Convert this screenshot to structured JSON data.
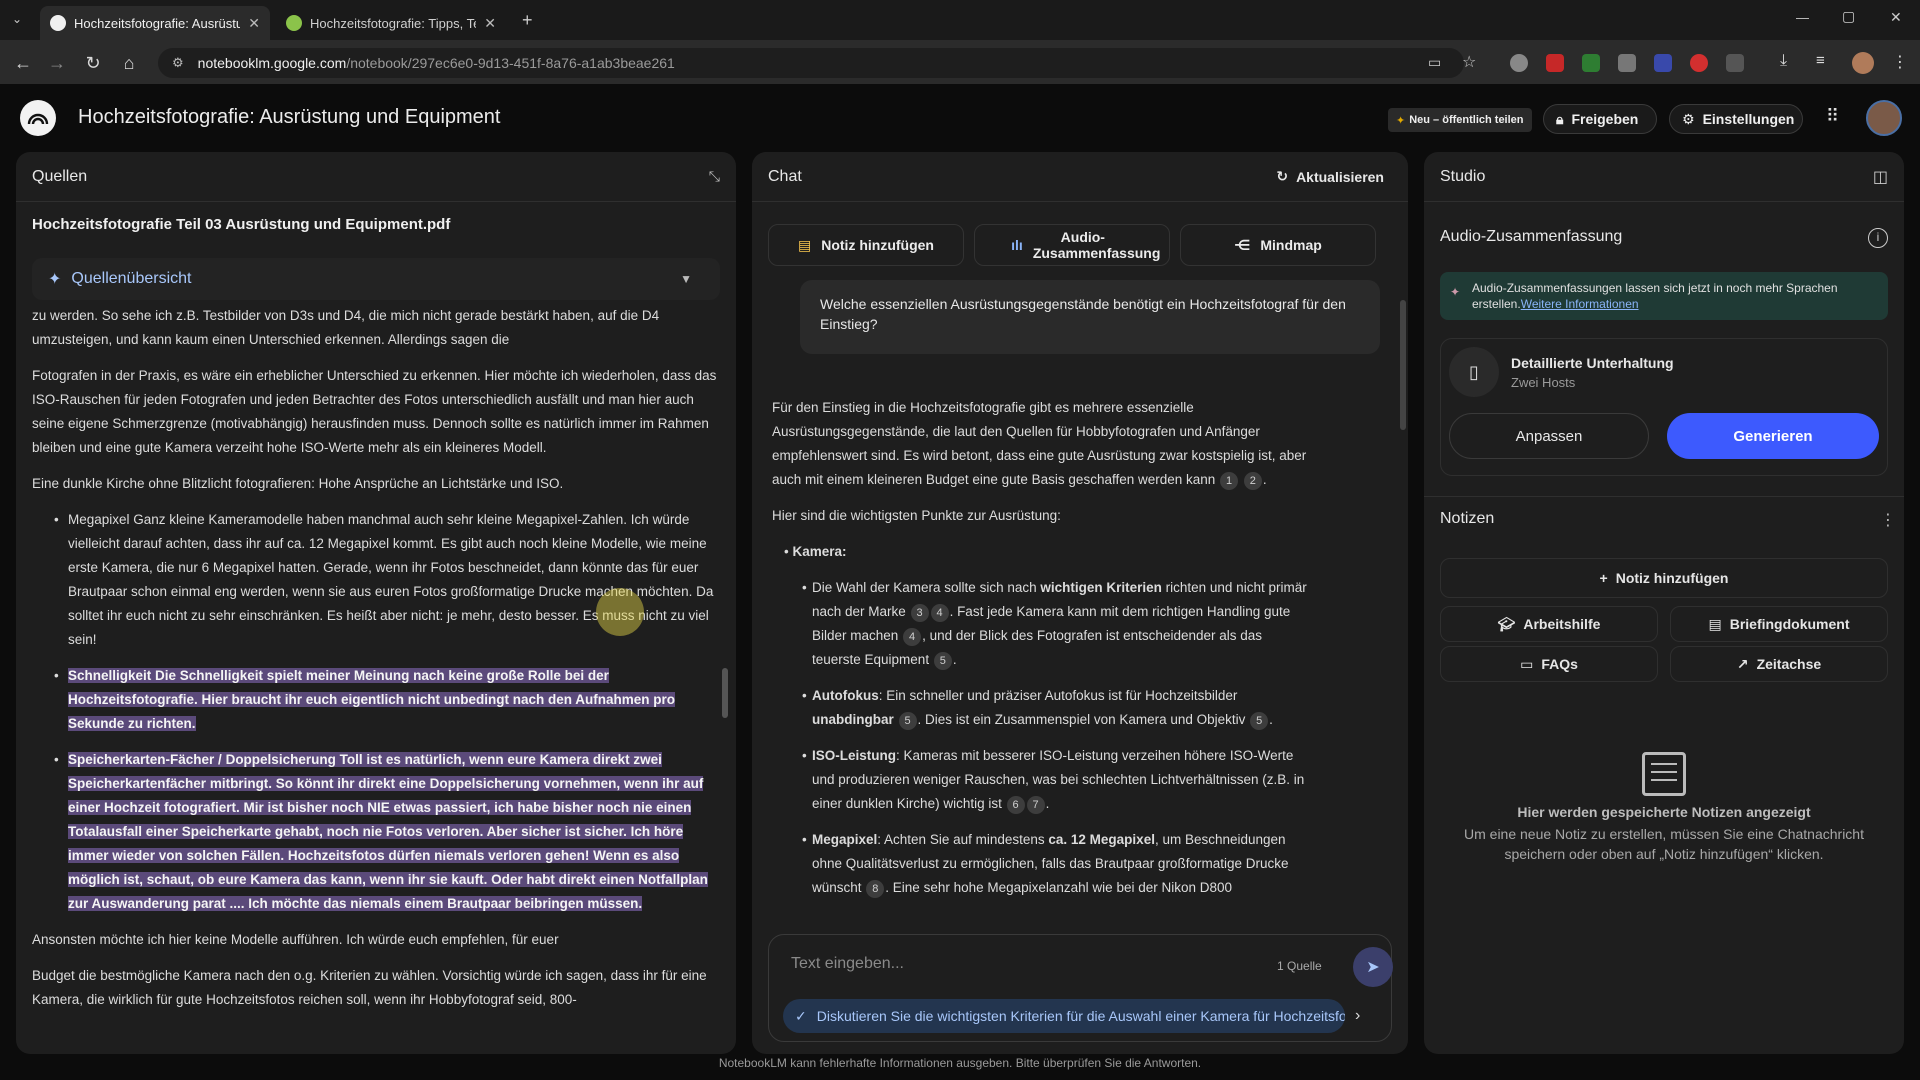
{
  "browser": {
    "tabs": [
      {
        "title": "Hochzeitsfotografie: Ausrüstung",
        "active": true
      },
      {
        "title": "Hochzeitsfotografie: Tipps, Tech",
        "active": false
      }
    ],
    "new_tab": "+",
    "url_host": "notebooklm.google.com",
    "url_path": "/notebook/297ec6e0-9d13-451f-8a76-a1ab3beae261",
    "window_controls": [
      "—",
      "▢",
      "✕"
    ]
  },
  "header": {
    "title": "Hochzeitsfotografie: Ausrüstung und Equipment",
    "new_public": "Neu – öffentlich teilen",
    "share": "Freigeben",
    "settings": "Einstellungen"
  },
  "sources": {
    "title": "Quellen",
    "file_name": "Hochzeitsfotografie Teil 03 Ausrüstung und Equipment.pdf",
    "overview_label": "Quellenübersicht",
    "paragraphs": [
      "zu werden. So sehe ich z.B. Testbilder von D3s und D4, die mich nicht gerade bestärkt haben, auf die D4 umzusteigen, und kann kaum einen Unterschied erkennen. Allerdings sagen die",
      "Fotografen in der Praxis, es wäre ein erheblicher Unterschied zu erkennen. Hier möchte ich wiederholen, dass das ISO-Rauschen für jeden Fotografen und jeden Betrachter des Fotos unterschiedlich ausfällt und man hier auch seine eigene Schmerzgrenze (motivabhängig) herausfinden muss. Dennoch sollte es natürlich immer im Rahmen bleiben und eine gute Kamera verzeiht hohe ISO-Werte mehr als ein kleineres Modell.",
      "Eine dunkle Kirche ohne Blitzlicht fotografieren: Hohe Ansprüche an Lichtstärke und ISO."
    ],
    "bullets": [
      {
        "text": "Megapixel Ganz kleine Kameramodelle haben manchmal auch sehr kleine Megapixel-Zahlen. Ich würde vielleicht darauf achten, dass ihr auf ca. 12 Megapixel kommt. Es gibt auch noch kleine Modelle, wie meine erste Kamera, die nur 6 Megapixel hatten. Gerade, wenn ihr Fotos beschneidet, dann könnte das für euer Brautpaar schon einmal eng werden, wenn sie aus euren Fotos großformatige Drucke machen möchten. Da solltet ihr euch nicht zu sehr einschränken. Es heißt aber nicht: je mehr, desto besser. Es muss nicht zu viel sein!",
        "highlight": false
      },
      {
        "text": "Schnelligkeit Die Schnelligkeit spielt meiner Meinung nach keine große Rolle bei der Hochzeitsfotografie. Hier braucht ihr euch eigentlich nicht unbedingt nach den Aufnahmen pro Sekunde zu richten.",
        "highlight": true
      },
      {
        "text": "Speicherkarten-Fächer / Doppelsicherung Toll ist es natürlich, wenn eure Kamera direkt zwei Speicherkartenfächer mitbringt. So könnt ihr direkt eine Doppelsicherung vornehmen, wenn ihr auf einer Hochzeit fotografiert. Mir ist bisher noch NIE etwas passiert, ich habe bisher noch nie einen Totalausfall einer Speicherkarte gehabt, noch nie Fotos verloren. Aber sicher ist sicher. Ich höre immer wieder von solchen Fällen. Hochzeitsfotos dürfen niemals verloren gehen! Wenn es also möglich ist, schaut, ob eure Kamera das kann, wenn ihr sie kauft. Oder habt direkt einen Notfallplan zur Auswanderung parat .... Ich möchte das niemals einem Brautpaar beibringen müssen.",
        "highlight": true
      }
    ],
    "trailing": [
      "Ansonsten möchte ich hier keine Modelle aufführen. Ich würde euch empfehlen, für euer",
      "Budget die bestmögliche Kamera nach den o.g. Kriterien zu wählen. Vorsichtig würde ich sagen, dass ihr für eine Kamera, die wirklich für gute Hochzeitsfotos reichen soll, wenn ihr Hobbyfotograf seid, 800-"
    ]
  },
  "chat": {
    "title": "Chat",
    "refresh": "Aktualisieren",
    "add_note": "Notiz hinzufügen",
    "audio_summary": "Audio-Zusammenfassung",
    "mindmap": "Mindmap",
    "question": "Welche essenziellen Ausrüstungsgegenstände benötigt ein Hochzeitsfotograf für den Einstieg?",
    "answer_intro": "Für den Einstieg in die Hochzeitsfotografie gibt es mehrere essenzielle Ausrüstungsgegenstände, die laut den Quellen für Hobbyfotografen und Anfänger empfehlenswert sind. Es wird betont, dass eine gute Ausrüstung zwar kostspielig ist, aber auch mit einem kleineren Budget eine gute Basis geschaffen werden kann",
    "intro_cites": [
      "1",
      "2"
    ],
    "points_heading": "Hier sind die wichtigsten Punkte zur Ausrüstung:",
    "camera_heading": "Kamera:",
    "camera_points": [
      {
        "a": "Die Wahl der Kamera sollte sich nach ",
        "b": "wichtigen Kriterien",
        "c": " richten und nicht primär nach der Marke",
        "cites1": [
          "3",
          "4"
        ],
        "d": ". Fast jede Kamera kann mit dem richtigen Handling gute Bilder machen",
        "cites2": [
          "4"
        ],
        "e": ", und der Blick des Fotografen ist entscheidender als das teuerste Equipment",
        "cites3": [
          "5"
        ],
        "f": "."
      },
      {
        "lead": "Autofokus",
        "text": ": Ein schneller und präziser Autofokus ist für Hochzeitsbilder ",
        "bold": "unabdingbar",
        "cites1": [
          "5"
        ],
        "text2": ". Dies ist ein Zusammenspiel von Kamera und Objektiv",
        "cites2": [
          "5"
        ]
      },
      {
        "lead": "ISO-Leistung",
        "text": ": Kameras mit besserer ISO-Leistung verzeihen höhere ISO-Werte und produzieren weniger Rauschen, was bei schlechten Lichtverhältnissen (z.B. in einer dunklen Kirche) wichtig ist",
        "cites1": [
          "6",
          "7"
        ]
      },
      {
        "lead": "Megapixel",
        "text": ": Achten Sie auf mindestens ",
        "bold": "ca. 12 Megapixel",
        "text2": ", um Beschneidungen ohne Qualitätsverlust zu ermöglichen, falls das Brautpaar großformatige Drucke wünscht",
        "cites1": [
          "8"
        ],
        "text3": ". Eine sehr hohe Megapixelanzahl wie bei der Nikon D800"
      }
    ],
    "input_placeholder": "Text eingeben...",
    "source_count": "1 Quelle",
    "suggestion": "Diskutieren Sie die wichtigsten Kriterien für die Auswahl einer Kamera für Hochzeitsfotografie"
  },
  "studio": {
    "title": "Studio",
    "audio_title": "Audio-Zusammenfassung",
    "banner_text": "Audio-Zusammenfassungen lassen sich jetzt in noch mehr Sprachen erstellen.",
    "banner_link": "Weitere Informationen",
    "conv_title": "Detaillierte Unterhaltung",
    "conv_sub": "Zwei Hosts",
    "customize": "Anpassen",
    "generate": "Generieren",
    "notes_title": "Notizen",
    "add_note": "Notiz hinzufügen",
    "study_guide": "Arbeitshilfe",
    "briefing": "Briefingdokument",
    "faqs": "FAQs",
    "timeline": "Zeitachse",
    "empty_title": "Hier werden gespeicherte Notizen angezeigt",
    "empty_sub": "Um eine neue Notiz zu erstellen, müssen Sie eine Chatnachricht speichern oder oben auf „Notiz hinzufügen“ klicken."
  },
  "footer": "NotebookLM kann fehlerhafte Informationen ausgeben. Bitte überprüfen Sie die Antworten.",
  "colors": {
    "accent": "#3d5afe",
    "highlight": "#5b4a7a",
    "link": "#a8c7fa"
  }
}
